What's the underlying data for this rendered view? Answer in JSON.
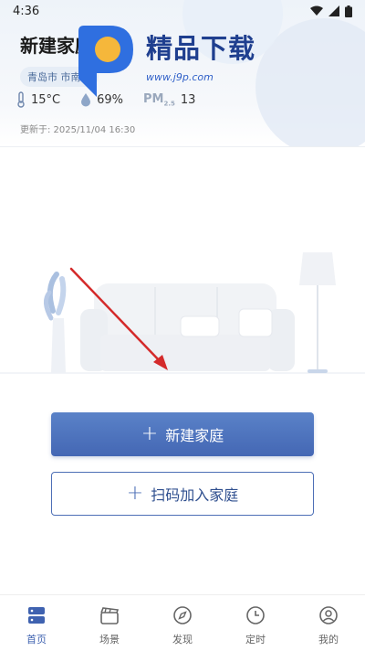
{
  "status_bar": {
    "time": "4:36"
  },
  "header": {
    "family_title": "新建家庭",
    "location": "青岛市 市南区",
    "temperature": "15°C",
    "humidity": "69%",
    "pm_label": "PM",
    "pm_sub": "2.5",
    "pm_value": "13",
    "updated": "更新于:   2025/11/04 16:30"
  },
  "watermark": {
    "text": "精品下载",
    "url": "www.j9p.com"
  },
  "actions": {
    "create_family": "新建家庭",
    "scan_join": "扫码加入家庭"
  },
  "tabs": [
    {
      "label": "首页",
      "icon": "home-icon",
      "active": true
    },
    {
      "label": "场景",
      "icon": "scene-icon",
      "active": false
    },
    {
      "label": "发现",
      "icon": "compass-icon",
      "active": false
    },
    {
      "label": "定时",
      "icon": "clock-icon",
      "active": false
    },
    {
      "label": "我的",
      "icon": "profile-icon",
      "active": false
    }
  ],
  "colors": {
    "accent": "#4467b4",
    "watermark": "#1f3f8f"
  }
}
